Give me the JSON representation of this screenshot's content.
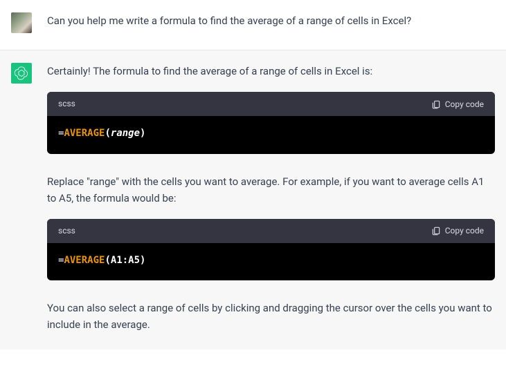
{
  "user": {
    "text": "Can you help me write a formula to find the average of a range of cells in Excel?"
  },
  "assistant": {
    "p1": "Certainly! The formula to find the average of a range of cells in Excel is:",
    "p2": "Replace \"range\" with the cells you want to average. For example, if you want to average cells A1 to A5, the formula would be:",
    "p3": "You can also select a range of cells by clicking and dragging the cursor over the cells you want to include in the average.",
    "code1": {
      "lang": "scss",
      "copy_label": "Copy code",
      "eq": "=",
      "func": "AVERAGE",
      "open": "(",
      "arg": "range",
      "close": ")"
    },
    "code2": {
      "lang": "scss",
      "copy_label": "Copy code",
      "eq": "=",
      "func": "AVERAGE",
      "open": "(",
      "arg": "A1:A5",
      "close": ")"
    }
  }
}
